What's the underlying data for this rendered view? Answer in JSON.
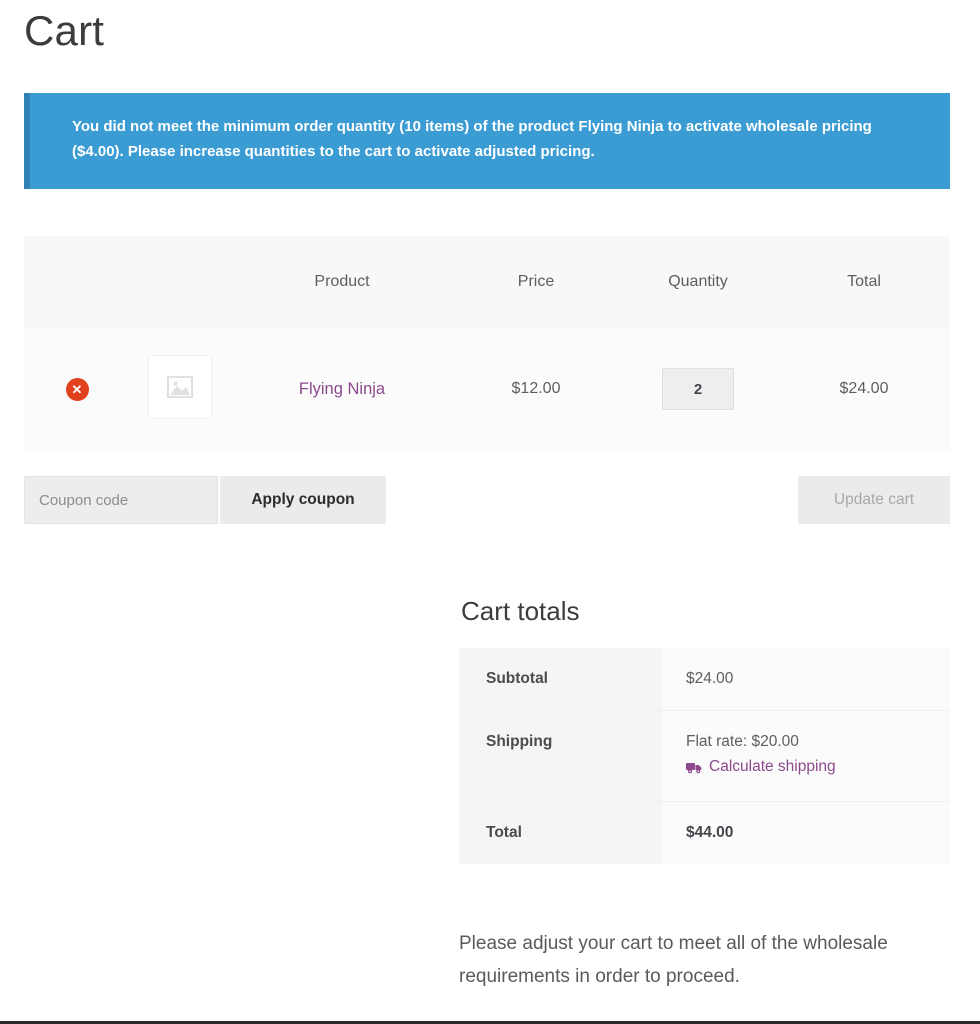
{
  "page": {
    "title": "Cart"
  },
  "notice": {
    "accent_color": "#3b9cd4",
    "border_color": "#2f83b4",
    "segments": [
      {
        "text": "You did not meet the minimum order quantity ",
        "bold": false
      },
      {
        "text": "(10 items)",
        "bold": true
      },
      {
        "text": " of the product ",
        "bold": false
      },
      {
        "text": "Flying Ninja",
        "bold": true
      },
      {
        "text": " to activate wholesale pricing ",
        "bold": false
      },
      {
        "text": "($4.00)",
        "bold": true
      },
      {
        "text": ". Please increase quantities to the cart to activate adjusted pricing.",
        "bold": false
      }
    ],
    "plain_text": "You did not meet the minimum order quantity (10 items) of the product Flying Ninja to activate wholesale pricing ($4.00). Please increase quantities to the cart to activate adjusted pricing."
  },
  "cart_table": {
    "headers": {
      "remove": "",
      "thumbnail": "",
      "product": "Product",
      "price": "Price",
      "quantity": "Quantity",
      "total": "Total"
    },
    "rows": [
      {
        "remove_label": "✕",
        "remove_icon": "remove-circle-icon",
        "thumbnail_icon": "image-placeholder-icon",
        "product_name": "Flying Ninja",
        "product_link_color": "#8c4a8c",
        "price": "$12.00",
        "quantity": "2",
        "total": "$24.00"
      }
    ]
  },
  "actions": {
    "coupon_placeholder": "Coupon code",
    "coupon_value": "",
    "apply_coupon_label": "Apply coupon",
    "update_cart_label": "Update cart"
  },
  "cart_totals": {
    "title": "Cart totals",
    "subtotal_label": "Subtotal",
    "subtotal_value": "$24.00",
    "shipping_label": "Shipping",
    "shipping_rate": "Flat rate: $20.00",
    "calculate_shipping_label": "Calculate shipping",
    "calculate_shipping_icon": "truck-icon",
    "total_label": "Total",
    "total_value": "$44.00"
  },
  "footer_note": "Please adjust your cart to meet all of the wholesale requirements in order to proceed."
}
